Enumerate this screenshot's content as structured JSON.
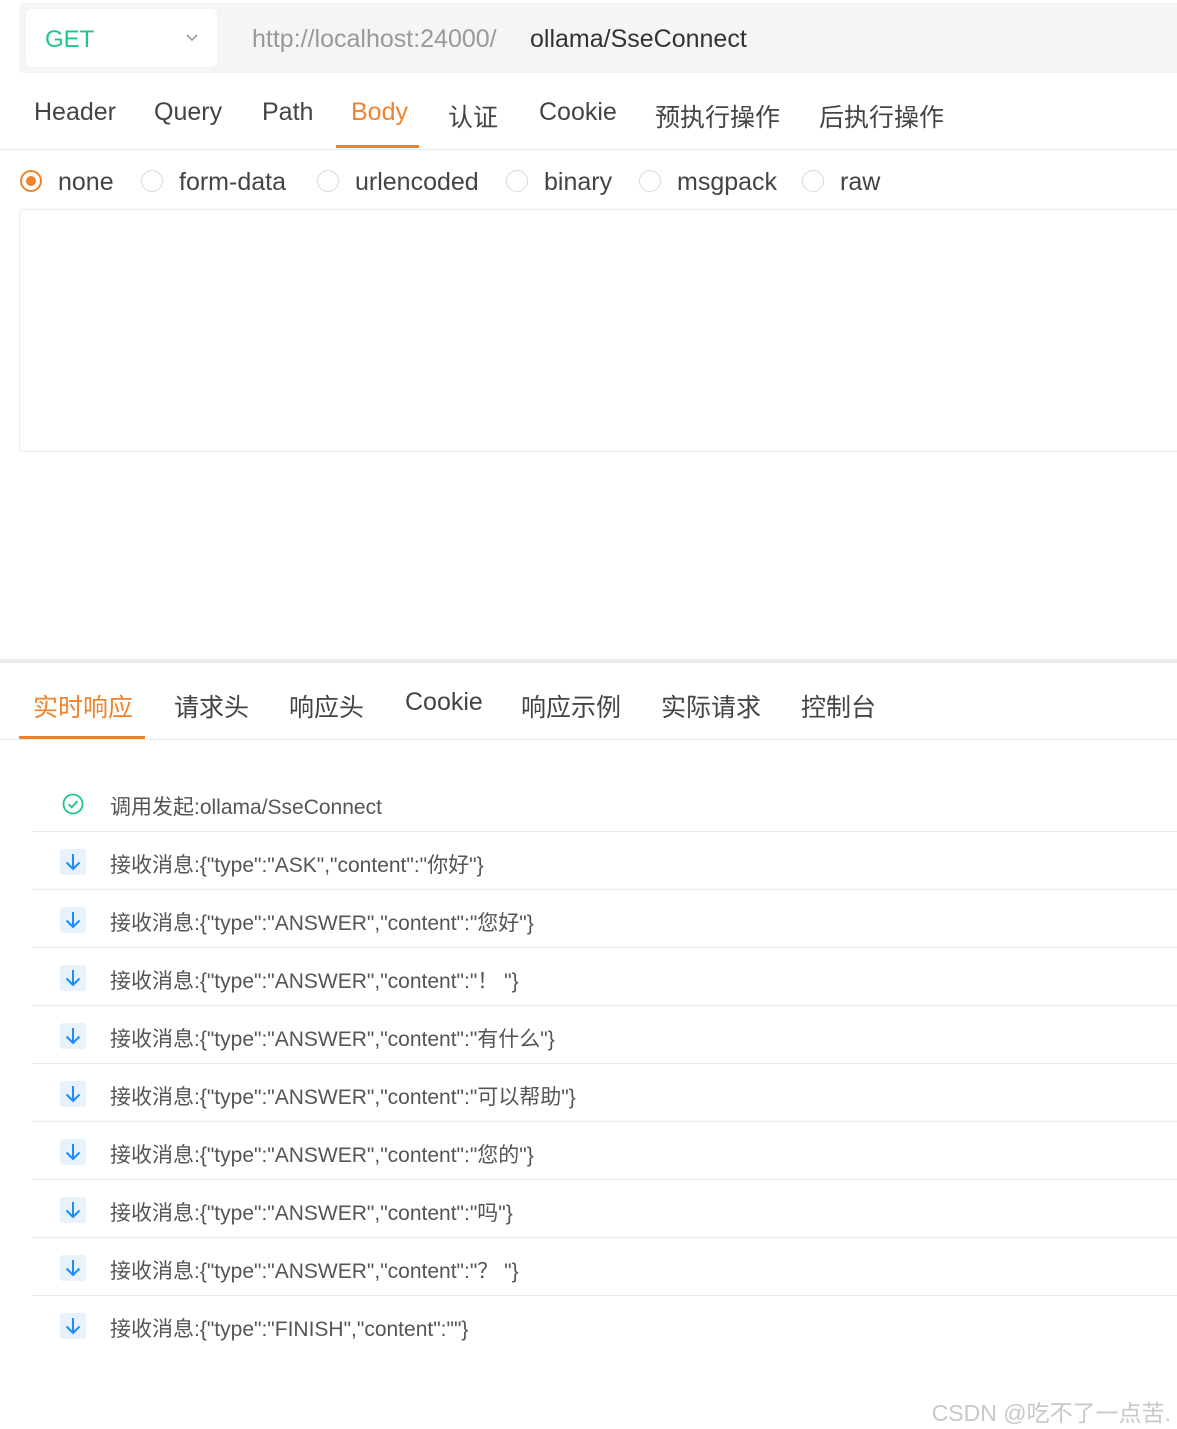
{
  "request": {
    "method": "GET",
    "url_prefix": "http://localhost:24000/",
    "url_path": "ollama/SseConnect"
  },
  "request_tabs": [
    {
      "label": "Header"
    },
    {
      "label": "Query"
    },
    {
      "label": "Path"
    },
    {
      "label": "Body",
      "active": true
    },
    {
      "label": "认证"
    },
    {
      "label": "Cookie"
    },
    {
      "label": "预执行操作"
    },
    {
      "label": "后执行操作"
    }
  ],
  "body_types": [
    {
      "label": "none",
      "checked": true
    },
    {
      "label": "form-data"
    },
    {
      "label": "urlencoded"
    },
    {
      "label": "binary"
    },
    {
      "label": "msgpack"
    },
    {
      "label": "raw"
    }
  ],
  "response_tabs": [
    {
      "label": "实时响应",
      "active": true
    },
    {
      "label": "请求头"
    },
    {
      "label": "响应头"
    },
    {
      "label": "Cookie"
    },
    {
      "label": "响应示例"
    },
    {
      "label": "实际请求"
    },
    {
      "label": "控制台"
    }
  ],
  "events": [
    {
      "icon": "check-circle-icon",
      "text": "调用发起:ollama/SseConnect"
    },
    {
      "icon": "arrow-down-icon",
      "text": "接收消息:{\"type\":\"ASK\",\"content\":\"你好\"}"
    },
    {
      "icon": "arrow-down-icon",
      "text": "接收消息:{\"type\":\"ANSWER\",\"content\":\"您好\"}"
    },
    {
      "icon": "arrow-down-icon",
      "text": "接收消息:{\"type\":\"ANSWER\",\"content\":\"！ \"}"
    },
    {
      "icon": "arrow-down-icon",
      "text": "接收消息:{\"type\":\"ANSWER\",\"content\":\"有什么\"}"
    },
    {
      "icon": "arrow-down-icon",
      "text": "接收消息:{\"type\":\"ANSWER\",\"content\":\"可以帮助\"}"
    },
    {
      "icon": "arrow-down-icon",
      "text": "接收消息:{\"type\":\"ANSWER\",\"content\":\"您的\"}"
    },
    {
      "icon": "arrow-down-icon",
      "text": "接收消息:{\"type\":\"ANSWER\",\"content\":\"吗\"}"
    },
    {
      "icon": "arrow-down-icon",
      "text": "接收消息:{\"type\":\"ANSWER\",\"content\":\"？ \"}"
    },
    {
      "icon": "arrow-down-icon",
      "text": "接收消息:{\"type\":\"FINISH\",\"content\":\"\"}"
    }
  ],
  "watermark": "CSDN @吃不了一点苦.",
  "colors": {
    "accent": "#f0832a",
    "method_get": "#23c28e",
    "success": "#23c28e",
    "received": "#1a8cff"
  }
}
